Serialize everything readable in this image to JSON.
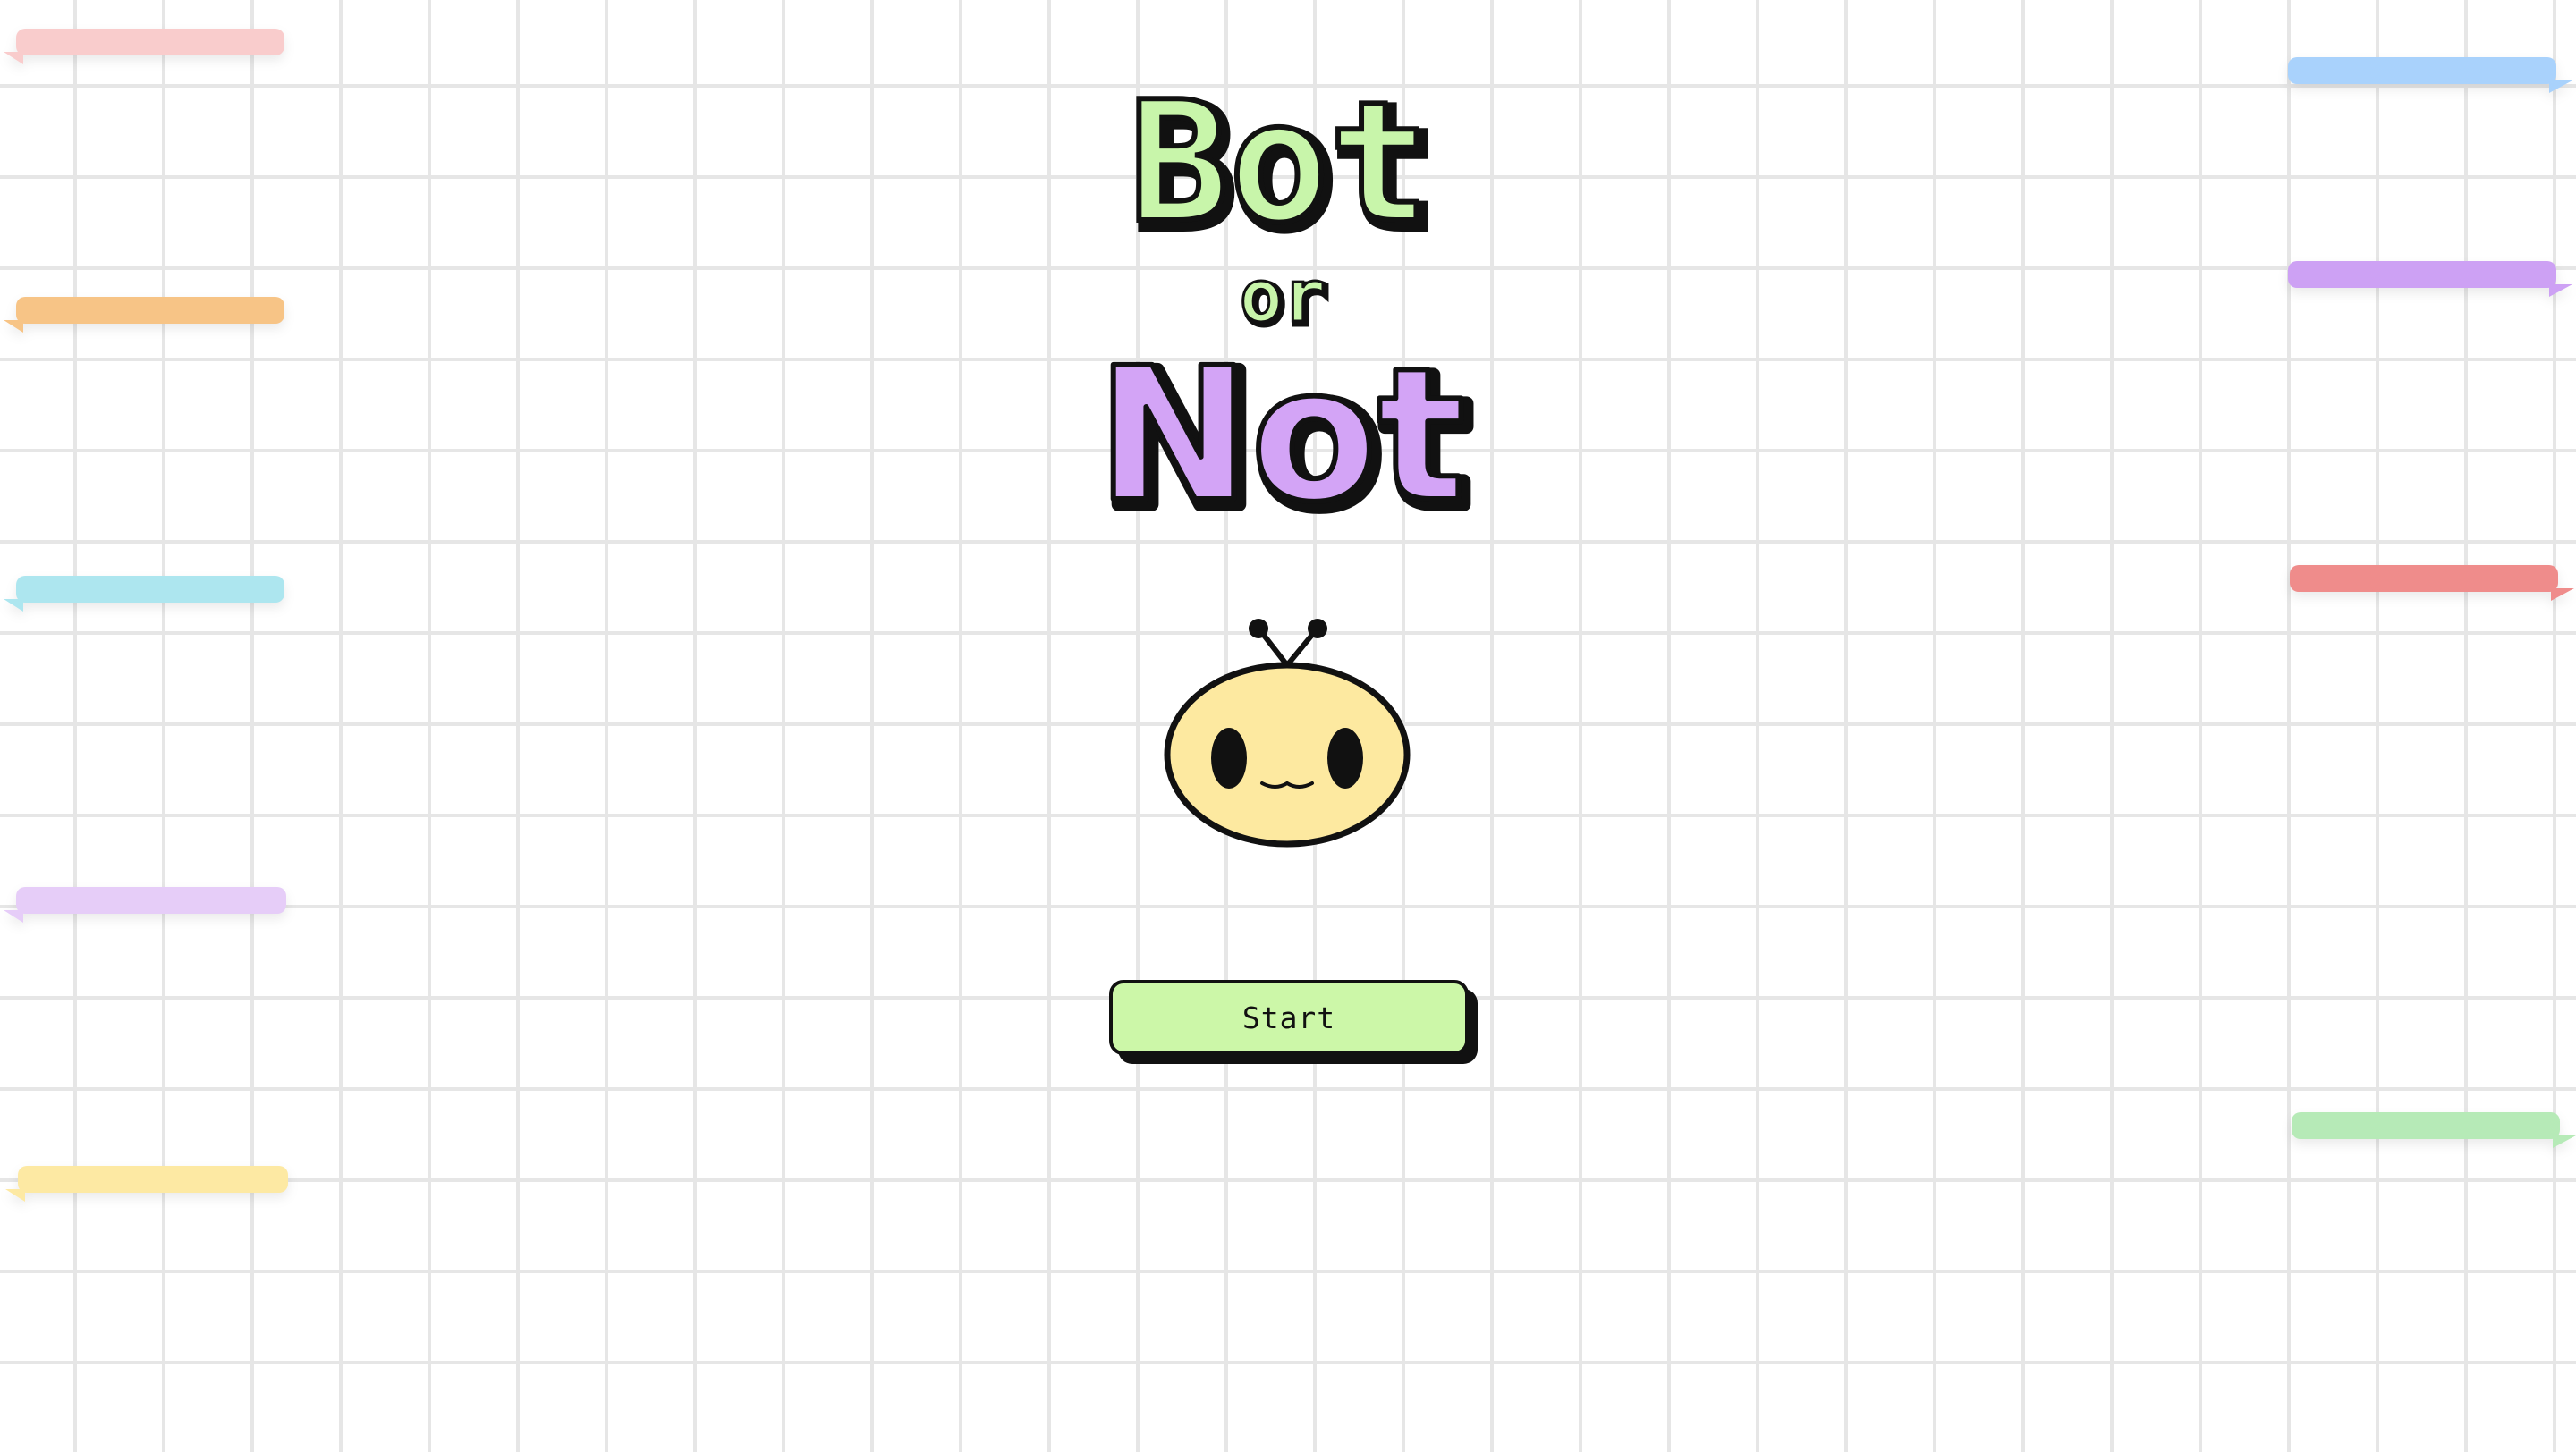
{
  "title": {
    "word1": "Bot",
    "word2": "or",
    "word3": "Not",
    "color_word1": "#c8f5aa",
    "color_word2": "#c8f5aa",
    "color_word3": "#d3a4f6"
  },
  "mascot": {
    "face_color": "#fde9a0",
    "outline_color": "#111111"
  },
  "start_button": {
    "label": "Start",
    "color": "#ccf7a8"
  },
  "decorations": {
    "left_bubbles": [
      {
        "color": "#f9cccc"
      },
      {
        "color": "#f7c486"
      },
      {
        "color": "#ade6ef"
      },
      {
        "color": "#e6cdf8"
      },
      {
        "color": "#fde9a3"
      }
    ],
    "right_bubbles": [
      {
        "color": "#a9d2fc"
      },
      {
        "color": "#cda1f4"
      },
      {
        "color": "#ef8c8b"
      },
      {
        "color": "#b6eab7"
      }
    ]
  }
}
